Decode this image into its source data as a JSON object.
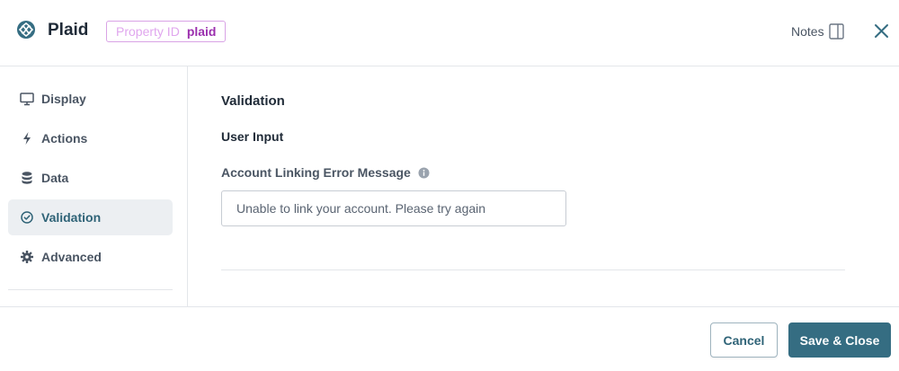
{
  "header": {
    "title": "Plaid",
    "property_badge": {
      "key": "Property ID",
      "value": "plaid"
    },
    "notes_label": "Notes",
    "icons": {
      "logo": "plaid-logo-icon",
      "notes": "panel-icon",
      "close": "close-icon"
    }
  },
  "sidebar": {
    "items": [
      {
        "label": "Display",
        "icon": "monitor-icon",
        "active": false
      },
      {
        "label": "Actions",
        "icon": "bolt-icon",
        "active": false
      },
      {
        "label": "Data",
        "icon": "database-icon",
        "active": false
      },
      {
        "label": "Validation",
        "icon": "check-circle-icon",
        "active": true
      },
      {
        "label": "Advanced",
        "icon": "gear-icon",
        "active": false
      }
    ]
  },
  "main": {
    "section_title": "Validation",
    "sub_title": "User Input",
    "field": {
      "label": "Account Linking Error Message",
      "placeholder": "Unable to link your account. Please try again",
      "value": ""
    }
  },
  "footer": {
    "cancel_label": "Cancel",
    "save_label": "Save & Close"
  },
  "colors": {
    "accent": "#356d82",
    "active_item_bg": "#eceff2",
    "badge_border": "#d9a3e6",
    "badge_value": "#9b2fae"
  }
}
